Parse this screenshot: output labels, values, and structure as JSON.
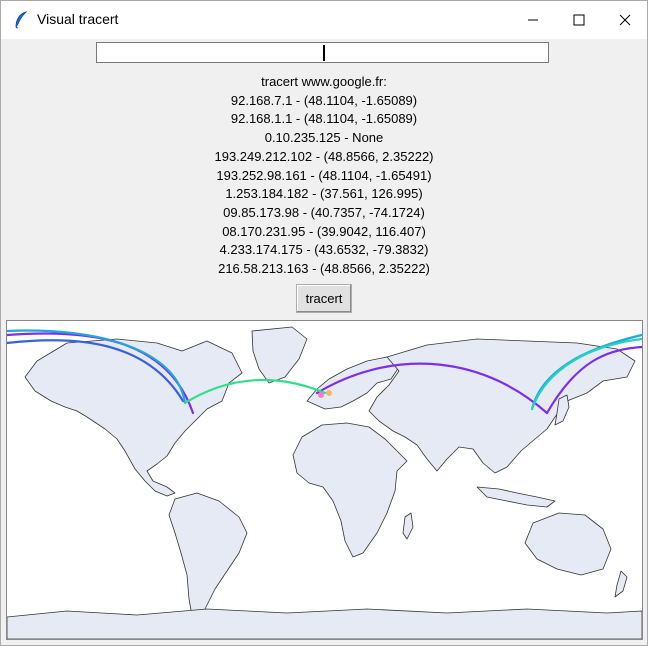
{
  "window": {
    "title": "Visual tracert",
    "icon": "feather-icon",
    "controls": [
      "minimize-icon",
      "maximize-icon",
      "close-icon"
    ]
  },
  "input": {
    "value": ""
  },
  "output": {
    "lines": [
      "tracert www.google.fr:",
      "92.168.7.1 - (48.1104, -1.65089)",
      "92.168.1.1 - (48.1104, -1.65089)",
      "0.10.235.125 - None",
      "193.249.212.102 - (48.8566, 2.35222)",
      "193.252.98.161 - (48.1104, -1.65491)",
      "1.253.184.182 - (37.561, 126.995)",
      "09.85.173.98 - (40.7357, -74.1724)",
      "08.170.231.95 - (39.9042, 116.407)",
      "4.233.174.175 - (43.6532, -79.3832)",
      "216.58.213.163 - (48.8566, 2.35222)"
    ]
  },
  "button": {
    "label": "tracert"
  },
  "map": {
    "land_color": "#e6eaf5",
    "coast_color": "#333333",
    "route_colors": [
      "#7b2ff0",
      "#3a5fe0",
      "#1fa9d9",
      "#21d3c0",
      "#2fe08a"
    ],
    "hop_marker_colors": [
      "#ff7ac8",
      "#ffb36b"
    ]
  }
}
